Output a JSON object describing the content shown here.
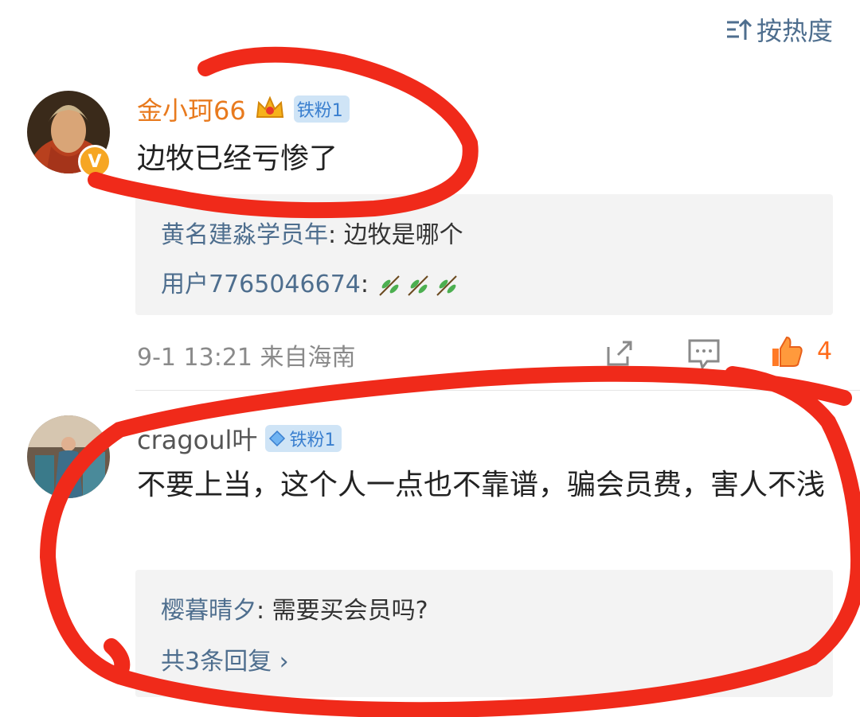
{
  "header": {
    "sort_label": "按热度",
    "sort_icon": "sort-icon"
  },
  "comments": [
    {
      "username": "金小珂66",
      "fan_badge": "铁粉1",
      "text": "边牧已经亏惨了",
      "verified": "V",
      "replies": [
        {
          "name": "黄名建淼学员年",
          "text": ": 边牧是哪个"
        },
        {
          "name": "用户7765046674",
          "text": ": "
        }
      ],
      "meta": "9-1 13:21 来自海南",
      "likes": "4"
    },
    {
      "username": "cragoul叶",
      "fan_badge": "铁粉1",
      "text": "不要上当，这个人一点也不靠谱，骗会员费，害人不浅",
      "replies": [
        {
          "name": "樱暮晴夕",
          "text": ": 需要买会员吗?"
        }
      ],
      "more_replies": "共3条回复 ›"
    }
  ],
  "colors": {
    "link": "#4e6e8e",
    "accent": "#ff6b1a",
    "annotation": "#f02a1a"
  }
}
